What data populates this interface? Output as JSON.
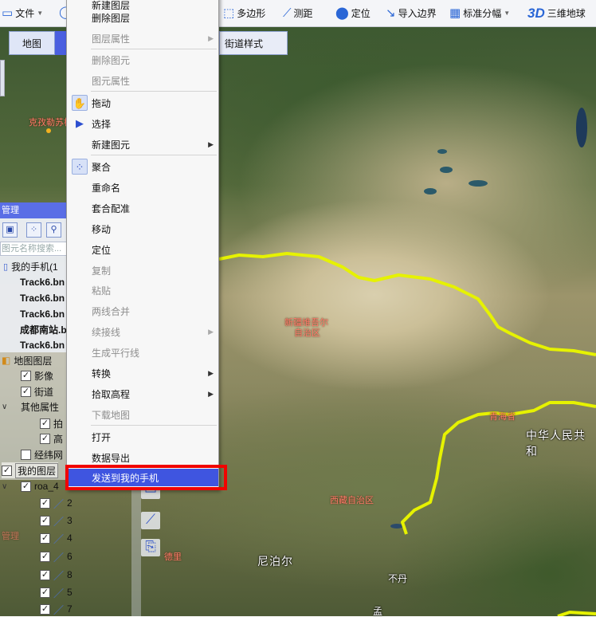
{
  "toolbar": {
    "file": "文件",
    "polygon": "多边形",
    "measure": "测距",
    "locate": "定位",
    "import_boundary": "导入边界",
    "standard_sheet": "标准分幅",
    "threeD_icon": "3D",
    "threeD_earth": "三维地球"
  },
  "tabs": {
    "map": "地图",
    "street_style": "街道样式"
  },
  "context_menu": {
    "items": [
      {
        "label": "新建图层",
        "enabled": true
      },
      {
        "label": "删除图层",
        "enabled": true
      },
      {
        "label": "图层属性",
        "enabled": false,
        "submenu": true
      },
      {
        "label": "删除图元",
        "enabled": false
      },
      {
        "label": "图元属性",
        "enabled": false
      },
      {
        "label": "拖动",
        "enabled": true,
        "icon": "hand-icon"
      },
      {
        "label": "选择",
        "enabled": true,
        "icon": "cursor-icon"
      },
      {
        "label": "新建图元",
        "enabled": true,
        "submenu": true
      },
      {
        "label": "聚合",
        "enabled": true,
        "icon": "cluster-icon"
      },
      {
        "label": "重命名",
        "enabled": true
      },
      {
        "label": "套合配准",
        "enabled": true
      },
      {
        "label": "移动",
        "enabled": true
      },
      {
        "label": "定位",
        "enabled": true
      },
      {
        "label": "复制",
        "enabled": false
      },
      {
        "label": "粘贴",
        "enabled": false
      },
      {
        "label": "两线合并",
        "enabled": false
      },
      {
        "label": "续接线",
        "enabled": false,
        "submenu": true
      },
      {
        "label": "生成平行线",
        "enabled": false
      },
      {
        "label": "转换",
        "enabled": true,
        "submenu": true
      },
      {
        "label": "拾取高程",
        "enabled": true,
        "submenu": true
      },
      {
        "label": "下载地图",
        "enabled": false
      },
      {
        "label": "打开",
        "enabled": true
      },
      {
        "label": "数据导出",
        "enabled": true
      },
      {
        "label": "发送到我的手机",
        "enabled": true,
        "highlighted": true
      }
    ]
  },
  "panel": {
    "title_fragment": "管理",
    "search_placeholder": "图元名称搜索...",
    "my_phone": "我的手机(1",
    "tracks": [
      "Track6.bn",
      "Track6.bn",
      "Track6.bn",
      "成都南站.b",
      "Track6.bn"
    ],
    "map_layers": "地图图层",
    "imagery": "影像",
    "street": "街道",
    "other_props": "其他属性",
    "other_a": "拍",
    "other_b": "高",
    "graticule": "经纬网",
    "my_layers": "我的图层",
    "layer_name": "roa_4",
    "sub_items": [
      "2",
      "3",
      "4",
      "6",
      "8",
      "5",
      "7"
    ]
  },
  "map_labels": {
    "city_red": "克孜勒苏柯",
    "xinjiang_line1": "新疆维吾尔",
    "xinjiang_line2": "自治区",
    "qinghai": "青海省",
    "china": "中华人民共和",
    "tibet": "西藏自治区",
    "nepal": "尼泊尔",
    "bhutan": "不丹",
    "india_frag": "德里",
    "left_frag": "管理",
    "bottom_frag": "孟"
  },
  "colors": {
    "highlight": "#3f55e0",
    "red_frame": "#f00400",
    "boundary_line": "#e6f200"
  }
}
